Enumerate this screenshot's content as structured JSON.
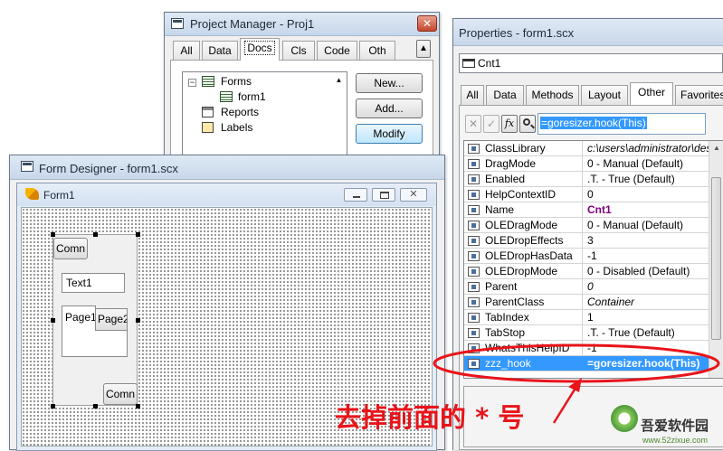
{
  "project_manager": {
    "title": "Project Manager - Proj1",
    "tabs": [
      "All",
      "Data",
      "Docs",
      "Cls",
      "Code",
      "Oth"
    ],
    "active_tab": "Docs",
    "tree": {
      "forms": "Forms",
      "form1": "form1",
      "reports": "Reports",
      "labels": "Labels"
    },
    "buttons": {
      "new": "New...",
      "add": "Add...",
      "modify": "Modify"
    }
  },
  "form_designer": {
    "title": "Form Designer - form1.scx",
    "form_caption": "Form1",
    "controls": {
      "command1": "Comn",
      "text1": "Text1",
      "page1": "Page1",
      "page2": "Page2",
      "command2": "Comn"
    }
  },
  "properties": {
    "title": "Properties - form1.scx",
    "object": "Cnt1",
    "tabs": [
      "All",
      "Data",
      "Methods",
      "Layout",
      "Other",
      "Favorites"
    ],
    "active_tab": "Other",
    "edit_value": "=goresizer.hook(This)",
    "rows": [
      {
        "name": "ClassLibrary",
        "value": "c:\\users\\administrator\\des",
        "style": "italic"
      },
      {
        "name": "DragMode",
        "value": "0 - Manual (Default)",
        "style": ""
      },
      {
        "name": "Enabled",
        "value": ".T. - True (Default)",
        "style": ""
      },
      {
        "name": "HelpContextID",
        "value": "0",
        "style": ""
      },
      {
        "name": "Name",
        "value": "Cnt1",
        "style": "boldpurple"
      },
      {
        "name": "OLEDragMode",
        "value": "0 - Manual (Default)",
        "style": ""
      },
      {
        "name": "OLEDropEffects",
        "value": "3",
        "style": ""
      },
      {
        "name": "OLEDropHasData",
        "value": "-1",
        "style": ""
      },
      {
        "name": "OLEDropMode",
        "value": "0 - Disabled (Default)",
        "style": ""
      },
      {
        "name": "Parent",
        "value": "0",
        "style": "italic"
      },
      {
        "name": "ParentClass",
        "value": "Container",
        "style": "italic"
      },
      {
        "name": "TabIndex",
        "value": "1",
        "style": ""
      },
      {
        "name": "TabStop",
        "value": ".T. - True (Default)",
        "style": ""
      },
      {
        "name": "WhatsThisHelpID",
        "value": "-1",
        "style": ""
      }
    ],
    "selected_row": {
      "name": "zzz_hook",
      "value": "=goresizer.hook(This)"
    }
  },
  "annotation": {
    "text": "去掉前面的 * 号",
    "color": "#e8141a"
  },
  "watermark": {
    "brand": "吾爱软件园",
    "url": "www.52zixue.com"
  },
  "colors": {
    "selection": "#3399ff",
    "annotation_red": "#e8141a"
  }
}
